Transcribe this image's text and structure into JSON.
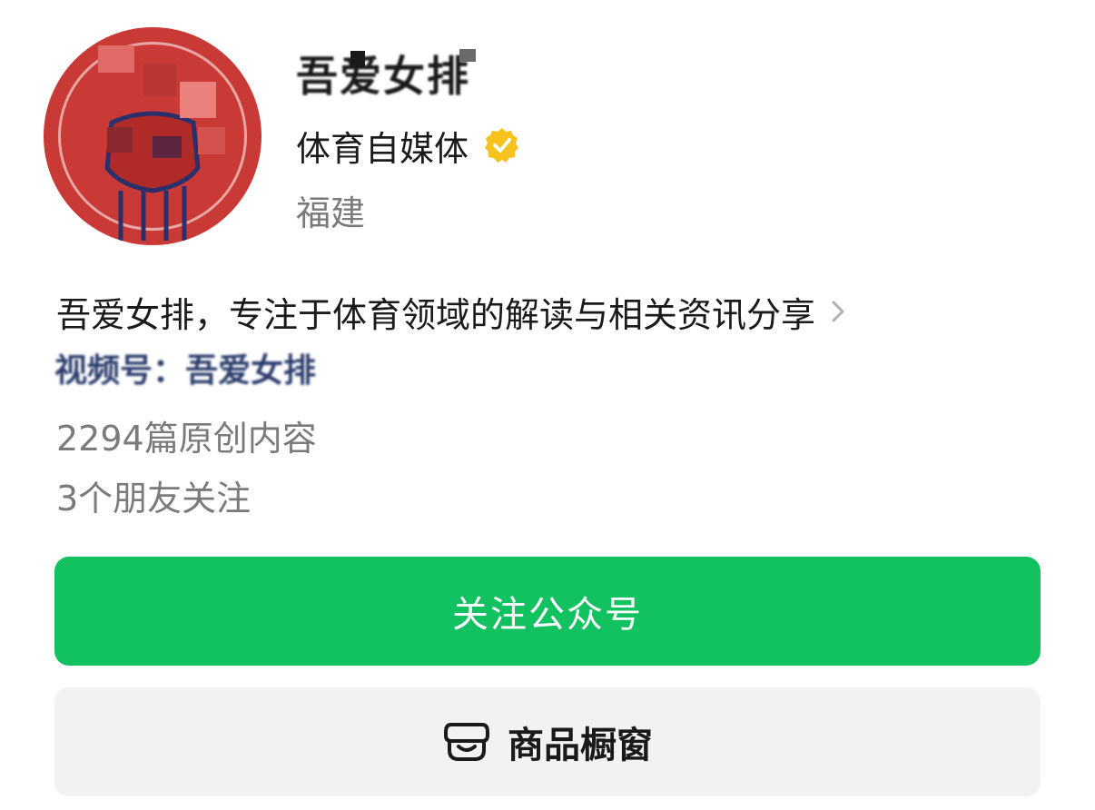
{
  "profile": {
    "name": "吾爱女排",
    "verification": "体育自媒体",
    "region": "福建",
    "bio": "吾爱女排，专注于体育领域的解读与相关资讯分享",
    "channel": "视频号：吾爱女排",
    "articles": "2294篇原创内容",
    "friends": "3个朋友关注"
  },
  "actions": {
    "follow_label": "关注公众号",
    "shop_label": "商品橱窗"
  },
  "colors": {
    "accent_green": "#12c15f",
    "verify_badge": "#f6c21b",
    "avatar_red": "#c93a36",
    "secondary_text": "#7a7a7a",
    "channel_link": "#2a3c6b"
  },
  "icons": {
    "verify": "verified-badge-icon",
    "chevron": "chevron-right-icon",
    "shop": "shop-window-icon"
  }
}
